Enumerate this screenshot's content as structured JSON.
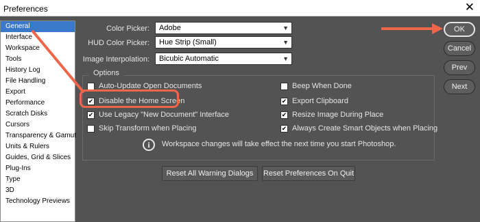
{
  "window": {
    "title": "Preferences",
    "close_glyph": "✕"
  },
  "sidebar": {
    "items": [
      {
        "label": "General",
        "active": true
      },
      {
        "label": "Interface"
      },
      {
        "label": "Workspace"
      },
      {
        "label": "Tools"
      },
      {
        "label": "History Log"
      },
      {
        "label": "File Handling"
      },
      {
        "label": "Export"
      },
      {
        "label": "Performance"
      },
      {
        "label": "Scratch Disks"
      },
      {
        "label": "Cursors"
      },
      {
        "label": "Transparency & Gamut"
      },
      {
        "label": "Units & Rulers"
      },
      {
        "label": "Guides, Grid & Slices"
      },
      {
        "label": "Plug-Ins"
      },
      {
        "label": "Type"
      },
      {
        "label": "3D"
      },
      {
        "label": "Technology Previews"
      }
    ]
  },
  "settings": {
    "color_picker": {
      "label": "Color Picker:",
      "value": "Adobe"
    },
    "hud_color_picker": {
      "label": "HUD Color Picker:",
      "value": "Hue Strip (Small)"
    },
    "image_interpolation": {
      "label": "Image Interpolation:",
      "value": "Bicubic Automatic"
    }
  },
  "options": {
    "legend": "Options",
    "left": [
      {
        "label": "Auto-Update Open Documents",
        "checked": false
      },
      {
        "label": "Disable the Home Screen",
        "checked": true
      },
      {
        "label": "Use Legacy \"New Document\" Interface",
        "checked": true
      },
      {
        "label": "Skip Transform when Placing",
        "checked": false
      }
    ],
    "right": [
      {
        "label": "Beep When Done",
        "checked": false
      },
      {
        "label": "Export Clipboard",
        "checked": true
      },
      {
        "label": "Resize Image During Place",
        "checked": true
      },
      {
        "label": "Always Create Smart Objects when Placing",
        "checked": true
      }
    ],
    "info_text": "Workspace changes will take effect the next time you start Photoshop."
  },
  "buttons": {
    "ok": "OK",
    "cancel": "Cancel",
    "prev": "Prev",
    "next": "Next",
    "reset_warnings": "Reset All Warning Dialogs",
    "reset_prefs": "Reset Preferences On Quit"
  },
  "annotation": {
    "color": "#f0664b"
  },
  "icons": {
    "info": "info-icon",
    "close": "close-icon",
    "dropdown": "chevron-down-icon",
    "check": "checkmark-icon"
  }
}
